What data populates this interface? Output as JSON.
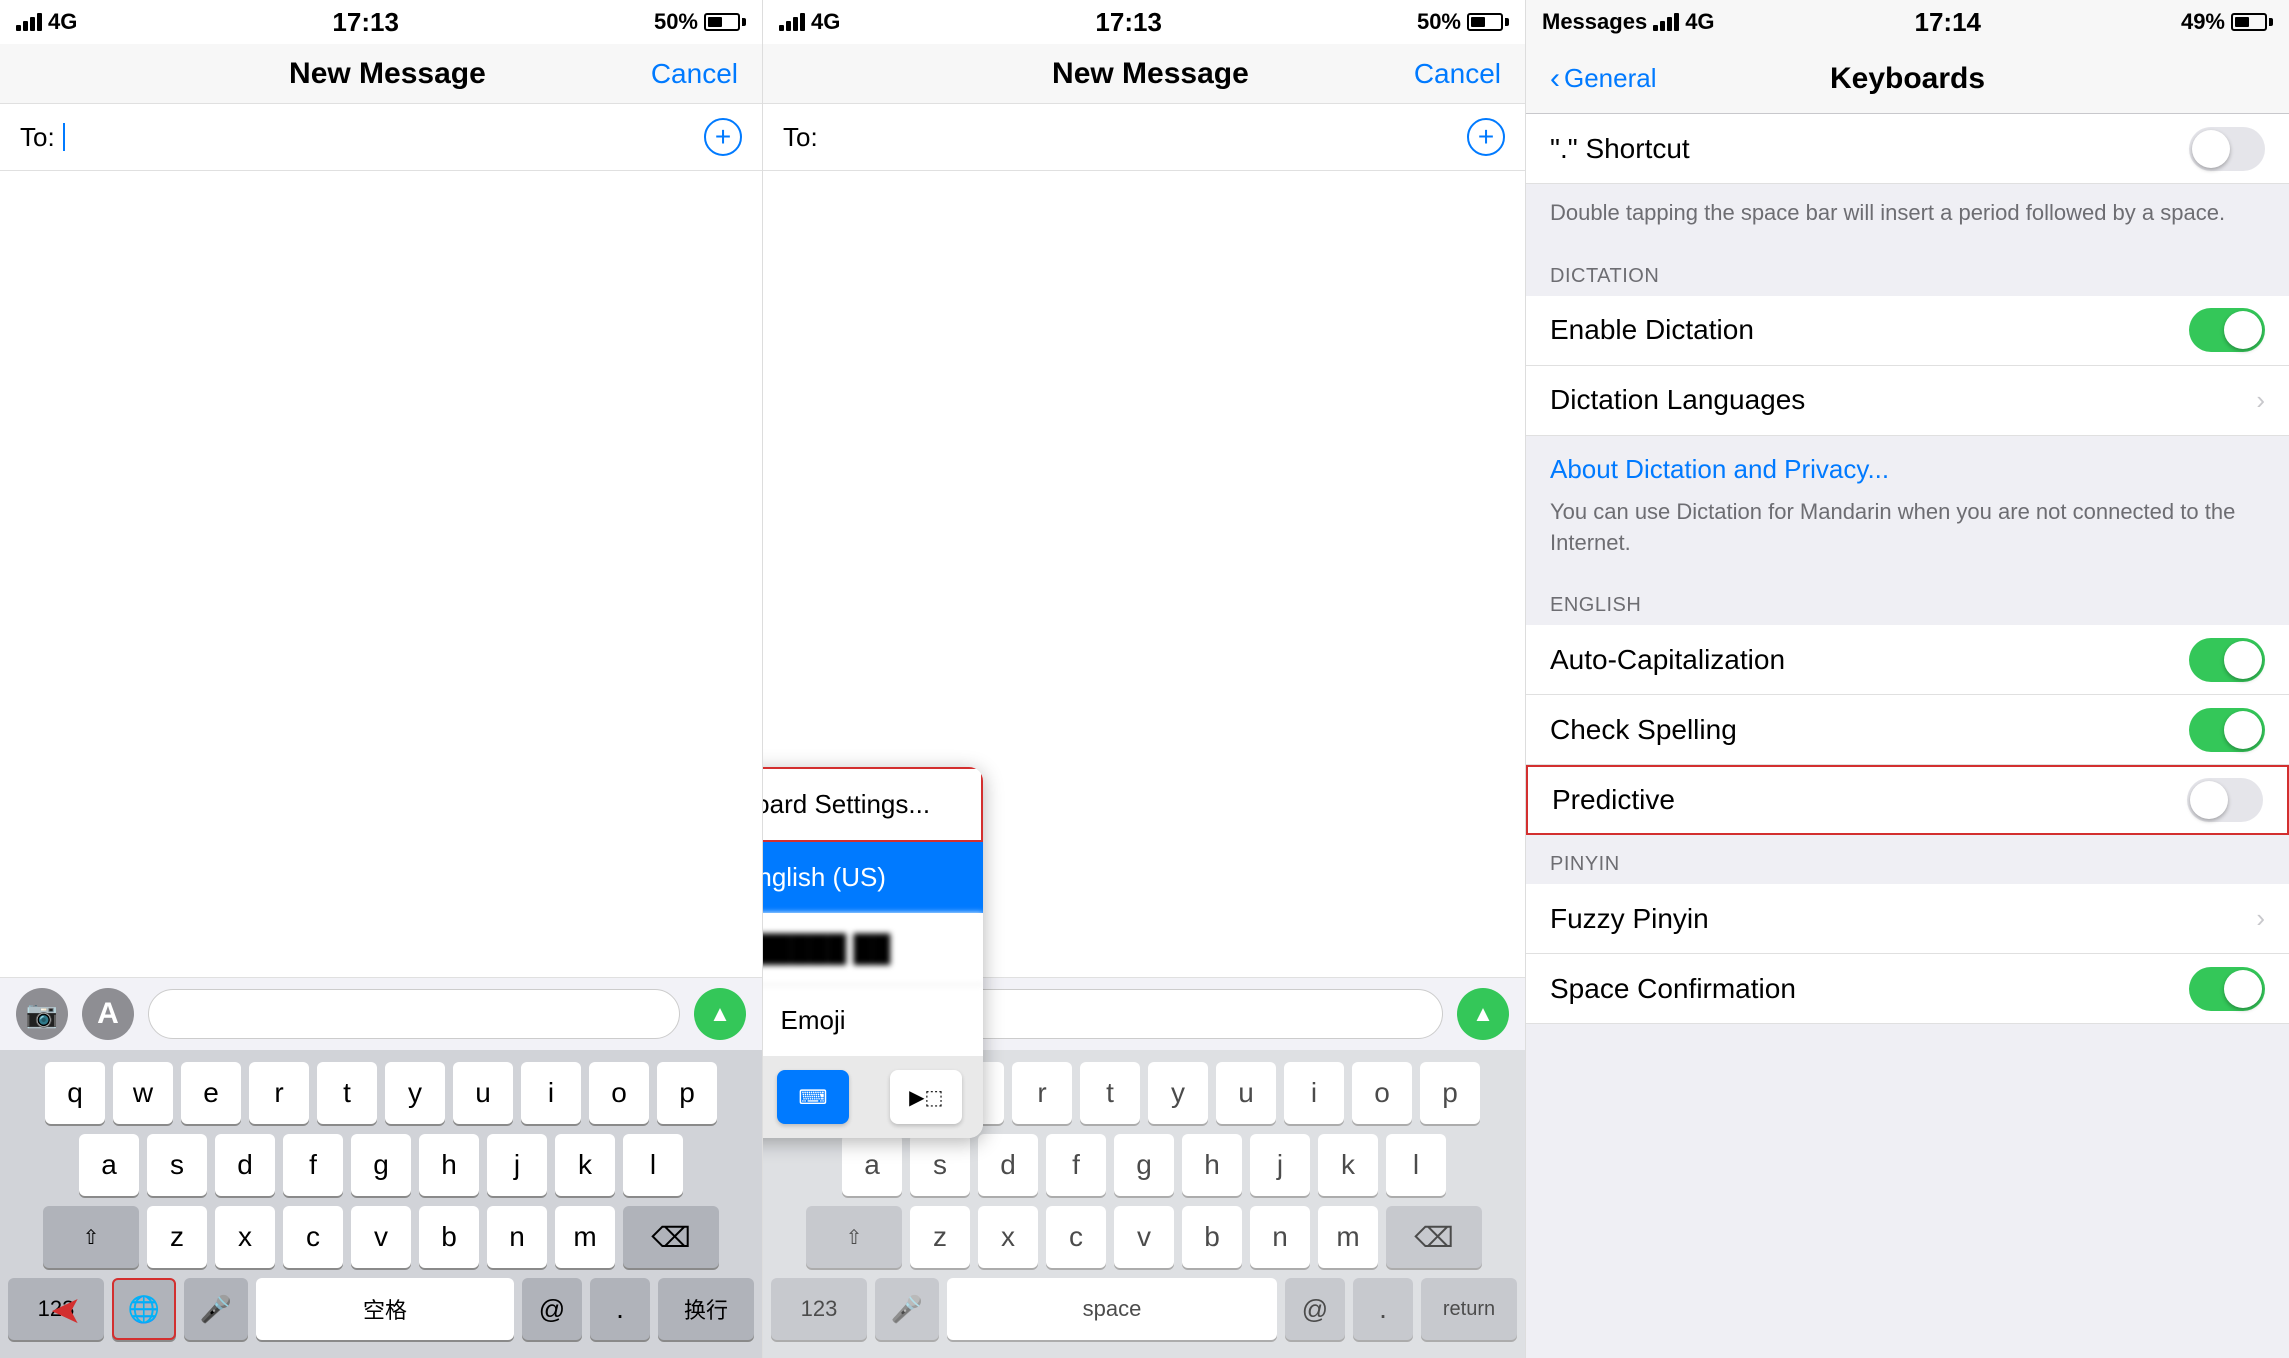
{
  "panel1": {
    "status": {
      "signal": "4G",
      "time": "17:13",
      "battery": "50%"
    },
    "nav": {
      "title": "New Message",
      "cancel": "Cancel"
    },
    "to_label": "To:",
    "plus_icon": "+",
    "imessage_bar": {
      "camera_icon": "📷",
      "appstore_icon": "A"
    },
    "keyboard": {
      "row1": [
        "q",
        "w",
        "e",
        "r",
        "t",
        "y",
        "u",
        "i",
        "o",
        "p"
      ],
      "row2": [
        "a",
        "s",
        "d",
        "f",
        "g",
        "h",
        "j",
        "k",
        "l"
      ],
      "row3": [
        "z",
        "x",
        "c",
        "v",
        "b",
        "n",
        "m"
      ],
      "numbers": "123",
      "globe": "🌐",
      "mic": "🎤",
      "space": "空格",
      "at": "@",
      "period": ".",
      "huanxing": "换行",
      "delete": "⌫"
    }
  },
  "panel2": {
    "status": {
      "signal": "4G",
      "time": "17:13",
      "battery": "50%"
    },
    "nav": {
      "title": "New Message",
      "cancel": "Cancel"
    },
    "to_label": "To:",
    "plus_icon": "+",
    "popup": {
      "keyboard_settings": "Keyboard Settings...",
      "english_us": "English (US)",
      "blurred": "██████ ██",
      "emoji": "Emoji",
      "kb_left": "⬛◀",
      "kb_center": "⌨",
      "kb_right": "▶⬛"
    },
    "keyboard": {
      "row1_partial": [
        "u",
        "i",
        "o",
        "p"
      ],
      "row2_partial": [
        "j",
        "k",
        "l"
      ],
      "row3_partial": [
        "n",
        "m"
      ],
      "numbers": "123",
      "mic": "🎤",
      "space": "space",
      "at": "@",
      "period": ".",
      "return": "return",
      "delete": "⌫"
    }
  },
  "panel3": {
    "status": {
      "signal": "4G",
      "time": "17:14",
      "battery": "49%",
      "app": "Messages"
    },
    "nav": {
      "back": "General",
      "title": "Keyboards"
    },
    "sections": {
      "shortcut": {
        "label": "\".\" Shortcut",
        "toggle": "off",
        "note": "Double tapping the space bar will insert a period followed by a space."
      },
      "dictation_header": "DICTATION",
      "enable_dictation": {
        "label": "Enable Dictation",
        "toggle": "on"
      },
      "dictation_languages": {
        "label": "Dictation Languages",
        "has_chevron": true
      },
      "dictation_link": "About Dictation and Privacy...",
      "dictation_note": "You can use Dictation for Mandarin when you are not connected to the Internet.",
      "english_header": "ENGLISH",
      "auto_capitalization": {
        "label": "Auto-Capitalization",
        "toggle": "on"
      },
      "check_spelling": {
        "label": "Check Spelling",
        "toggle": "on"
      },
      "predictive": {
        "label": "Predictive",
        "toggle": "off",
        "highlighted": true
      },
      "pinyin_header": "PINYIN",
      "fuzzy_pinyin": {
        "label": "Fuzzy Pinyin",
        "has_chevron": true
      },
      "space_confirmation": {
        "label": "Space Confirmation",
        "toggle": "on"
      }
    }
  }
}
